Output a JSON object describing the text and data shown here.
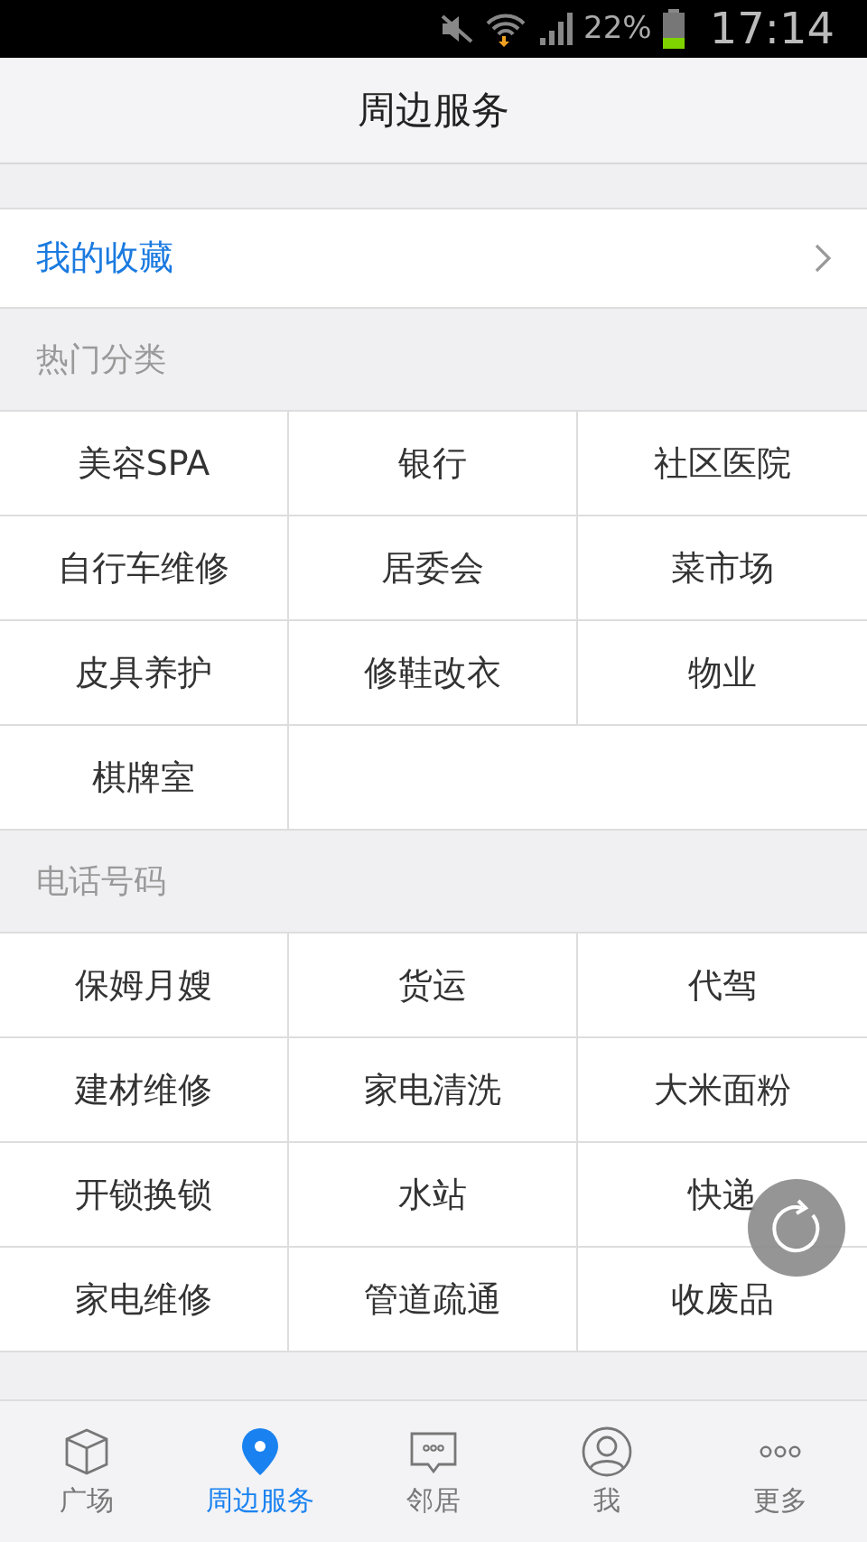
{
  "status_bar": {
    "battery_text": "22%",
    "time": "17:14"
  },
  "header": {
    "title": "周边服务"
  },
  "favorites": {
    "label": "我的收藏"
  },
  "sections": [
    {
      "title": "热门分类",
      "items": [
        "美容SPA",
        "银行",
        "社区医院",
        "自行车维修",
        "居委会",
        "菜市场",
        "皮具养护",
        "修鞋改衣",
        "物业",
        "棋牌室"
      ]
    },
    {
      "title": "电话号码",
      "items": [
        "保姆月嫂",
        "货运",
        "代驾",
        "建材维修",
        "家电清洗",
        "大米面粉",
        "开锁换锁",
        "水站",
        "快递",
        "家电维修",
        "管道疏通",
        "收废品"
      ]
    }
  ],
  "tabs": [
    {
      "label": "广场",
      "kind": "cube",
      "selected": false
    },
    {
      "label": "周边服务",
      "kind": "pin",
      "selected": true
    },
    {
      "label": "邻居",
      "kind": "chat",
      "selected": false
    },
    {
      "label": "我",
      "kind": "person",
      "selected": false
    },
    {
      "label": "更多",
      "kind": "dots",
      "selected": false
    }
  ]
}
